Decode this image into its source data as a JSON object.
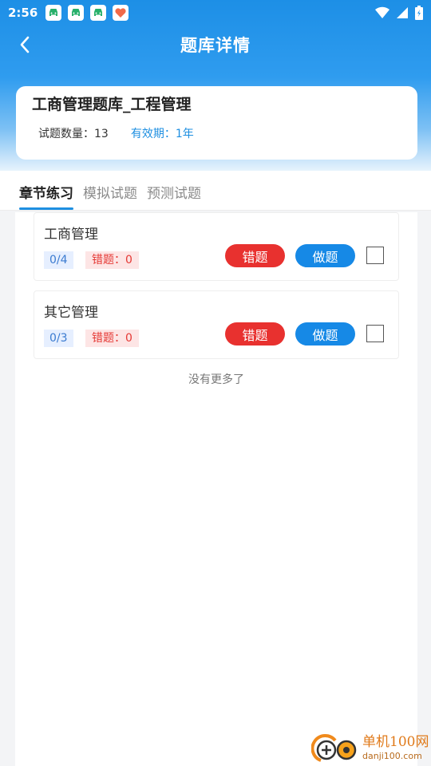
{
  "status_bar": {
    "time": "2:56",
    "notification_icons": [
      "car-app-icon",
      "car-app-icon",
      "car-app-icon",
      "heart-app-icon"
    ],
    "right_icons": [
      "wifi-icon",
      "signal-icon",
      "battery-icon"
    ]
  },
  "header": {
    "title": "题库详情"
  },
  "bank": {
    "name": "工商管理题库_工程管理",
    "count_label": "试题数量：13",
    "validity_label": "有效期：1年"
  },
  "tabs": [
    {
      "label": "章节练习",
      "active": true
    },
    {
      "label": "模拟试题",
      "active": false
    },
    {
      "label": "预测试题",
      "active": false
    }
  ],
  "chapters": [
    {
      "name": "工商管理",
      "progress": "0/4",
      "wrong": "错题：0",
      "wrong_button": "错题",
      "do_button": "做题",
      "checked": false
    },
    {
      "name": "其它管理",
      "progress": "0/3",
      "wrong": "错题：0",
      "wrong_button": "错题",
      "do_button": "做题",
      "checked": false
    }
  ],
  "list_footer": "没有更多了",
  "watermark": {
    "name": "单机100网",
    "url": "danji100.com"
  },
  "colors": {
    "accent": "#1e8fe1",
    "wrong_button": "#e8312f",
    "do_button": "#1689e6"
  }
}
